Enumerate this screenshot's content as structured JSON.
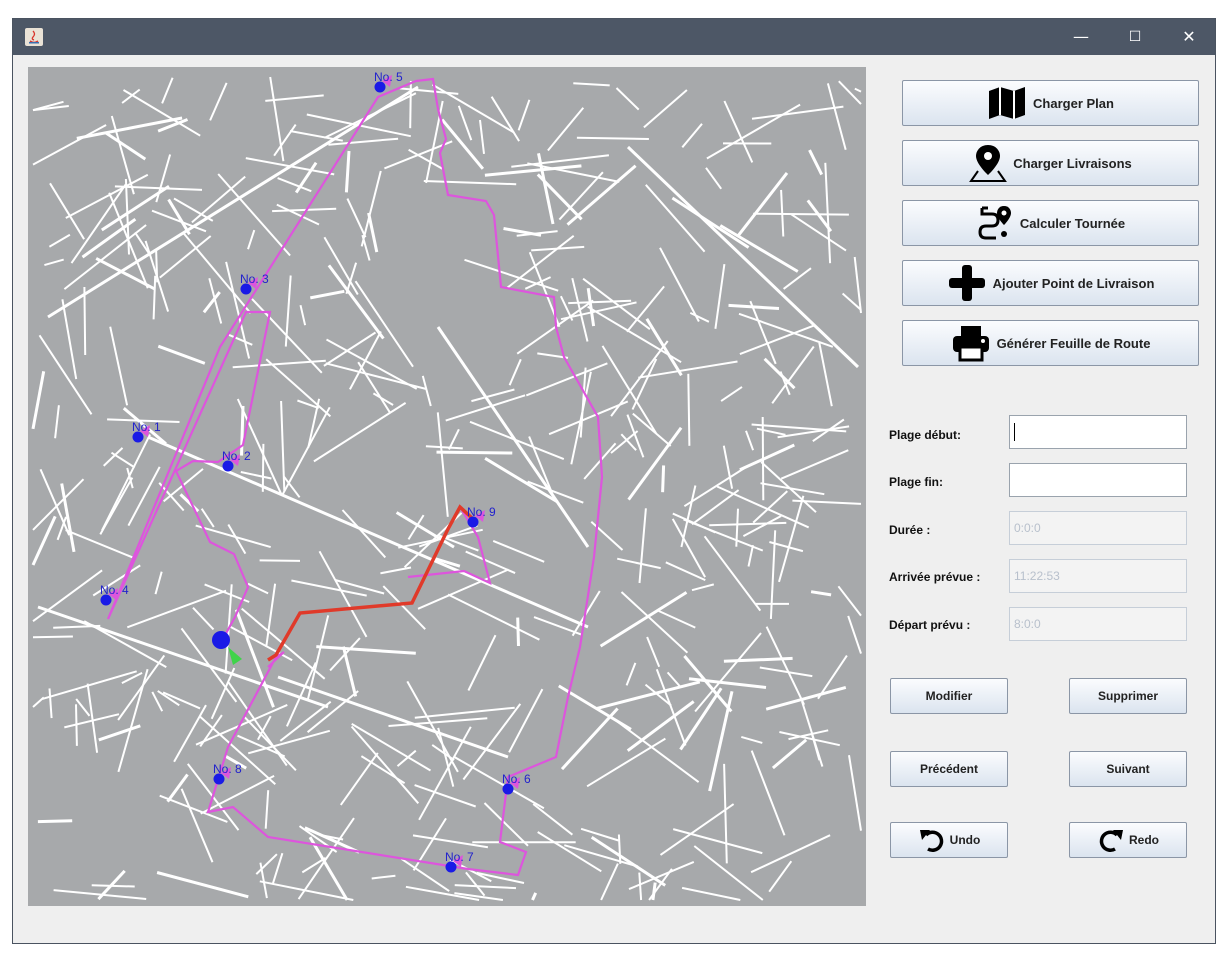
{
  "window": {
    "minimize_glyph": "—",
    "maximize_glyph": "☐",
    "close_glyph": "✕"
  },
  "toolbar": {
    "load_plan": "Charger Plan",
    "load_deliveries": "Charger Livraisons",
    "compute_tour": "Calculer Tournée",
    "add_point": "Ajouter Point de Livraison",
    "generate_sheet": "Générer Feuille de Route"
  },
  "form": {
    "plage_debut_label": "Plage début:",
    "plage_debut_value": "",
    "plage_fin_label": "Plage fin:",
    "plage_fin_value": "",
    "duree_label": "Durée :",
    "duree_value": "0:0:0",
    "arrivee_label": "Arrivée prévue :",
    "arrivee_value": "11:22:53",
    "depart_label": "Départ prévu :",
    "depart_value": "8:0:0"
  },
  "actions": {
    "modify": "Modifier",
    "delete": "Supprimer",
    "previous": "Précédent",
    "next": "Suivant",
    "undo": "Undo",
    "redo": "Redo"
  },
  "map": {
    "route_color": "#dd55dd",
    "highlight_color": "#e03a2a",
    "marker_color": "#1a1ae6",
    "label_color": "#2222cc",
    "deliveries": [
      {
        "label": "No. 1"
      },
      {
        "label": "No. 2"
      },
      {
        "label": "No. 3"
      },
      {
        "label": "No. 4"
      },
      {
        "label": "No. 5"
      },
      {
        "label": "No. 6"
      },
      {
        "label": "No. 7"
      },
      {
        "label": "No. 8"
      },
      {
        "label": "No. 9"
      }
    ]
  },
  "icons": {
    "app": "java-icon",
    "load_plan": "map-icon",
    "load_deliveries": "location-pin-icon",
    "compute_tour": "route-icon",
    "add_point": "plus-icon",
    "generate_sheet": "printer-icon",
    "undo": "undo-icon",
    "redo": "redo-icon"
  }
}
